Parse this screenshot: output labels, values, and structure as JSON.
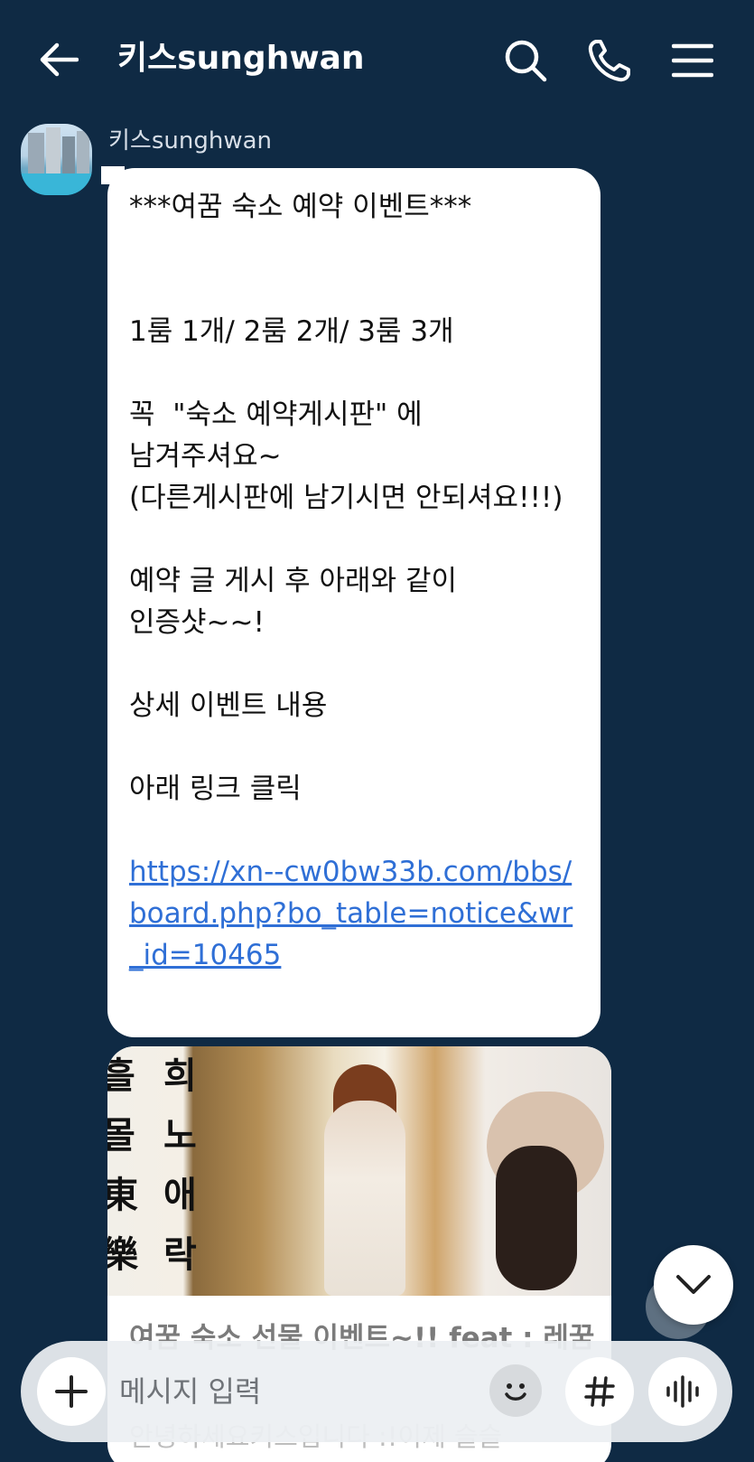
{
  "header": {
    "title": "키스sunghwan",
    "icons": [
      "back-arrow-icon",
      "search-icon",
      "phone-icon",
      "menu-icon"
    ]
  },
  "message": {
    "sender": "키스sunghwan",
    "lines": [
      "***여꿈 숙소 예약 이벤트***",
      "",
      "",
      "1룸 1개/ 2룸 2개/ 3룸 3개",
      "",
      "꼭  \"숙소 예약게시판\" 에",
      "남겨주셔요~",
      "(다른게시판에 남기시면 안되셔요!!!)",
      "",
      "예약 글 게시 후 아래와 같이",
      "인증샷~~!",
      "",
      "상세 이벤트 내용",
      "",
      "아래 링크 클릭",
      ""
    ],
    "link": "https://xn--cw0bw33b.com/bbs/board.php?bo_table=notice&wr_id=10465"
  },
  "preview": {
    "image_text_left": "흘 몰 東 樂",
    "image_text_right": "희 노 애 락",
    "title": "여꿈 숙소 선물 이벤트~!! feat : 레꿈",
    "description": "안녕하세요키스입니다 :!이제 슬슬"
  },
  "input": {
    "placeholder": "메시지 입력"
  },
  "colors": {
    "background": "#0f2a44",
    "link": "#2f6fd6",
    "bubble": "#ffffff"
  }
}
